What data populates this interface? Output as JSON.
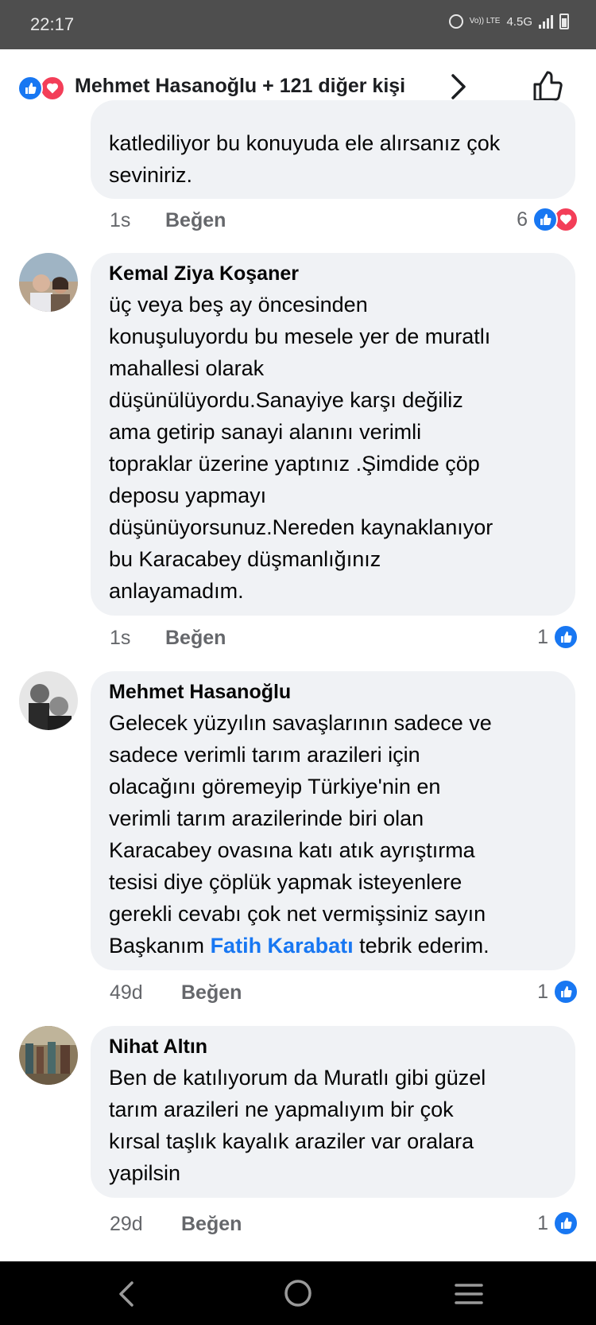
{
  "status_bar": {
    "time": "22:17",
    "volte": "Vo)) LTE",
    "network": "4.5G"
  },
  "reaction_summary": {
    "text": "Mehmet Hasanoğlu + 121 diğer kişi"
  },
  "comments": [
    {
      "text": "katlediliyor bu konuyuda ele alırsanız çok\nseviniriz.",
      "time": "1s",
      "like_label": "Beğen",
      "reaction_count": "6",
      "reactions": [
        "like-icon",
        "love-icon"
      ]
    },
    {
      "author": "Kemal Ziya Koşaner",
      "text": "üç veya beş ay öncesinden\nkonuşuluyordu bu mesele yer de muratlı\nmahallesi olarak\ndüşünülüyordu.Sanayiye karşı değiliz\nama getirip sanayi alanını verimli\ntopraklar üzerine yaptınız .Şimdide çöp\ndeposu yapmayı\ndüşünüyorsunuz.Nereden kaynaklanıyor\nbu Karacabey  düşmanlığınız\nanlayamadım.",
      "time": "1s",
      "like_label": "Beğen",
      "reaction_count": "1",
      "reactions": [
        "like-icon"
      ]
    },
    {
      "author": "Mehmet Hasanoğlu",
      "text": "Gelecek yüzyılın savaşlarının sadece ve\nsadece verimli tarım arazileri için\nolacağını göremeyip Türkiye'nin en\nverimli tarım arazilerinde biri olan\nKaracabey ovasına katı atık ayrıştırma\ntesisi diye çöplük yapmak isteyenlere\ngerekli cevabı çok net vermişsiniz sayın\nBaşkanım ",
      "mention": "Fatih Karabatı",
      "text_after": " tebrik ederim.",
      "time": "49d",
      "like_label": "Beğen",
      "reaction_count": "1",
      "reactions": [
        "like-icon"
      ]
    },
    {
      "author": "Nihat Altın",
      "text": "Ben de katılıyorum da Muratlı gibi güzel\ntarım arazileri ne yapmalıyım bir çok\nkırsal taşlık kayalık araziler var oralara\nyapilsin",
      "time": "29d",
      "like_label": "Beğen",
      "reaction_count": "1",
      "reactions": [
        "like-icon"
      ]
    }
  ],
  "nav_bar": {
    "buttons": [
      "back",
      "home",
      "recents"
    ]
  },
  "colors": {
    "accent": "#1877f2",
    "love": "#f33e58",
    "bubble": "#f0f2f5",
    "meta": "#65676b"
  }
}
